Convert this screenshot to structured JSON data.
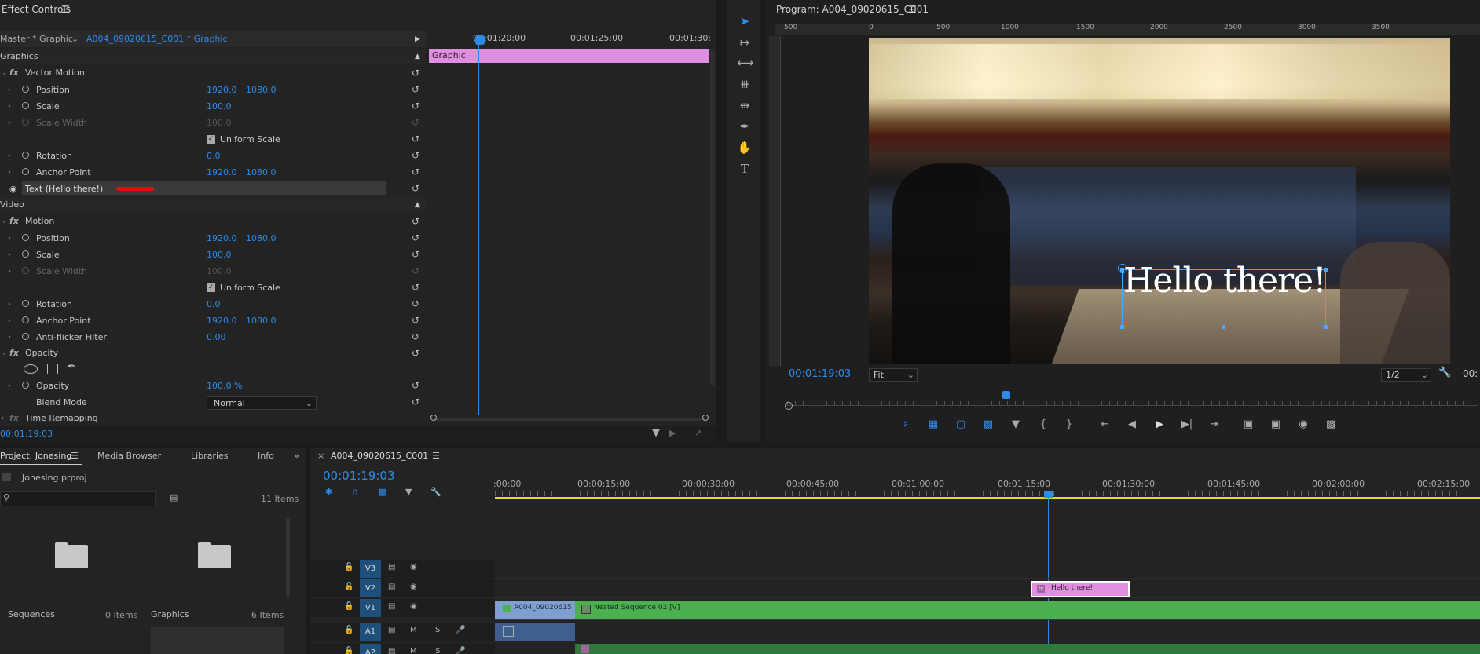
{
  "effect_controls": {
    "title": "Effect Controls",
    "master_label": "Master * Graphic",
    "clip_label": "A004_09020615_C001 * Graphic",
    "timecodes": [
      "00:01:20:00",
      "00:01:25:00",
      "00:01:30:"
    ],
    "graphic_bar_label": "Graphic",
    "bottom_timecode": "00:01:19:03",
    "sections": {
      "graphics": "Graphics",
      "vector_motion": "Vector Motion",
      "video": "Video",
      "motion": "Motion",
      "opacity_group": "Opacity",
      "time_remap": "Time Remapping"
    },
    "graphics_rows": [
      {
        "label": "Position",
        "v1": "1920.0",
        "v2": "1080.0"
      },
      {
        "label": "Scale",
        "v1": "100.0",
        "v2": ""
      },
      {
        "label": "Scale Width",
        "v1": "100.0",
        "v2": ""
      },
      {
        "label": "Uniform Scale",
        "v1": "",
        "v2": ""
      },
      {
        "label": "Rotation",
        "v1": "0.0",
        "v2": ""
      },
      {
        "label": "Anchor Point",
        "v1": "1920.0",
        "v2": "1080.0"
      }
    ],
    "text_layer": "Text (Hello there!)",
    "video_rows": [
      {
        "label": "Position",
        "v1": "1920.0",
        "v2": "1080.0"
      },
      {
        "label": "Scale",
        "v1": "100.0",
        "v2": ""
      },
      {
        "label": "Scale Width",
        "v1": "100.0",
        "v2": ""
      },
      {
        "label": "Uniform Scale",
        "v1": "",
        "v2": ""
      },
      {
        "label": "Rotation",
        "v1": "0.0",
        "v2": ""
      },
      {
        "label": "Anchor Point",
        "v1": "1920.0",
        "v2": "1080.0"
      },
      {
        "label": "Anti-flicker Filter",
        "v1": "0.00",
        "v2": ""
      }
    ],
    "opacity_row": {
      "label": "Opacity",
      "value": "100.0 %"
    },
    "blend_mode": {
      "label": "Blend Mode",
      "value": "Normal"
    }
  },
  "program_monitor": {
    "title": "Program: A004_09020615_C001",
    "ruler_labels": [
      "500",
      "0",
      "500",
      "1000",
      "1500",
      "2000",
      "2500",
      "3000",
      "3500"
    ],
    "overlay_text": "Hello there!",
    "timecode": "00:01:19:03",
    "fit": "Fit",
    "resolution": "1/2",
    "right_timecode": "00:"
  },
  "project": {
    "tabs": [
      "Project: Jonesing",
      "Media Browser",
      "Libraries",
      "Info"
    ],
    "file": "Jonesing.prproj",
    "item_count": "11 Items",
    "bins": [
      {
        "name": "Sequences",
        "count": "0 Items"
      },
      {
        "name": "Graphics",
        "count": "6 Items"
      }
    ]
  },
  "timeline": {
    "title": "A004_09020615_C001",
    "timecode": "00:01:19:03",
    "ruler": [
      ":00:00",
      "00:00:15:00",
      "00:00:30:00",
      "00:00:45:00",
      "00:01:00:00",
      "00:01:15:00",
      "00:01:30:00",
      "00:01:45:00",
      "00:02:00:00",
      "00:02:15:00"
    ],
    "tracks": [
      "V3",
      "V2",
      "V1",
      "A1",
      "A2"
    ],
    "track_mute": "M",
    "track_solo": "S",
    "clips": {
      "graphic": "Hello there!",
      "v1_clip": "A004_09020615",
      "nested": "Nested Sequence 02 [V]"
    }
  },
  "colors": {
    "accent": "#2d8ceb",
    "graphic_clip": "#e08ee0",
    "video_clip": "#4caf50",
    "v1_clip": "#7f9fd0"
  }
}
